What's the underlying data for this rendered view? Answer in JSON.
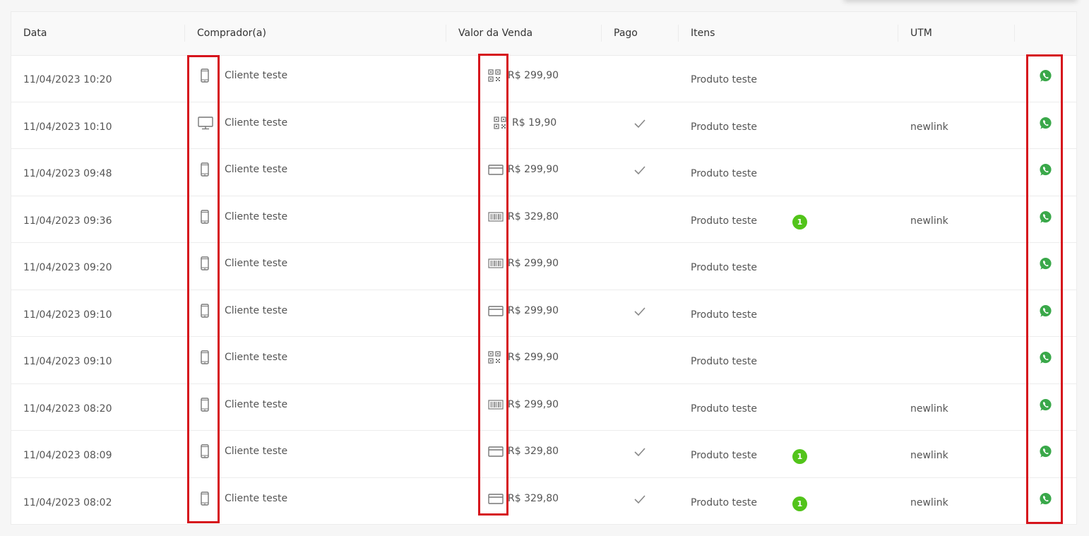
{
  "columns": {
    "date": "Data",
    "buyer": "Comprador(a)",
    "value": "Valor da Venda",
    "paid": "Pago",
    "items": "Itens",
    "utm": "UTM"
  },
  "rows": [
    {
      "date": "11/04/2023 10:20",
      "device": "mobile-icon",
      "buyer": "Cliente teste",
      "payment": "qrcode-icon",
      "value": "R$ 299,90",
      "paid": false,
      "item": "Produto teste",
      "badge": "",
      "utm": ""
    },
    {
      "date": "11/04/2023 10:10",
      "device": "desktop-icon",
      "buyer": "Cliente teste",
      "payment": "qrcode-icon",
      "value": "R$ 19,90",
      "paid": true,
      "item": "Produto teste",
      "badge": "",
      "utm": "newlink"
    },
    {
      "date": "11/04/2023 09:48",
      "device": "mobile-icon",
      "buyer": "Cliente teste",
      "payment": "credit-card-icon",
      "value": "R$ 299,90",
      "paid": true,
      "item": "Produto teste",
      "badge": "",
      "utm": ""
    },
    {
      "date": "11/04/2023 09:36",
      "device": "mobile-icon",
      "buyer": "Cliente teste",
      "payment": "barcode-icon",
      "value": "R$ 329,80",
      "paid": false,
      "item": "Produto teste",
      "badge": "1",
      "utm": "newlink"
    },
    {
      "date": "11/04/2023 09:20",
      "device": "mobile-icon",
      "buyer": "Cliente teste",
      "payment": "barcode-icon",
      "value": "R$ 299,90",
      "paid": false,
      "item": "Produto teste",
      "badge": "",
      "utm": ""
    },
    {
      "date": "11/04/2023 09:10",
      "device": "mobile-icon",
      "buyer": "Cliente teste",
      "payment": "credit-card-icon",
      "value": "R$ 299,90",
      "paid": true,
      "item": "Produto teste",
      "badge": "",
      "utm": ""
    },
    {
      "date": "11/04/2023 09:10",
      "device": "mobile-icon",
      "buyer": "Cliente teste",
      "payment": "qrcode-icon",
      "value": "R$ 299,90",
      "paid": false,
      "item": "Produto teste",
      "badge": "",
      "utm": ""
    },
    {
      "date": "11/04/2023 08:20",
      "device": "mobile-icon",
      "buyer": "Cliente teste",
      "payment": "barcode-icon",
      "value": "R$ 299,90",
      "paid": false,
      "item": "Produto teste",
      "badge": "",
      "utm": "newlink"
    },
    {
      "date": "11/04/2023 08:09",
      "device": "mobile-icon",
      "buyer": "Cliente teste",
      "payment": "credit-card-icon",
      "value": "R$ 329,80",
      "paid": true,
      "item": "Produto teste",
      "badge": "1",
      "utm": "newlink"
    },
    {
      "date": "11/04/2023 08:02",
      "device": "mobile-icon",
      "buyer": "Cliente teste",
      "payment": "credit-card-icon",
      "value": "R$ 329,80",
      "paid": true,
      "item": "Produto teste",
      "badge": "1",
      "utm": "newlink"
    }
  ],
  "colors": {
    "highlight": "#d6141c",
    "whatsapp": "#3aa84a",
    "badge": "#52c41a",
    "icon": "#777777"
  }
}
